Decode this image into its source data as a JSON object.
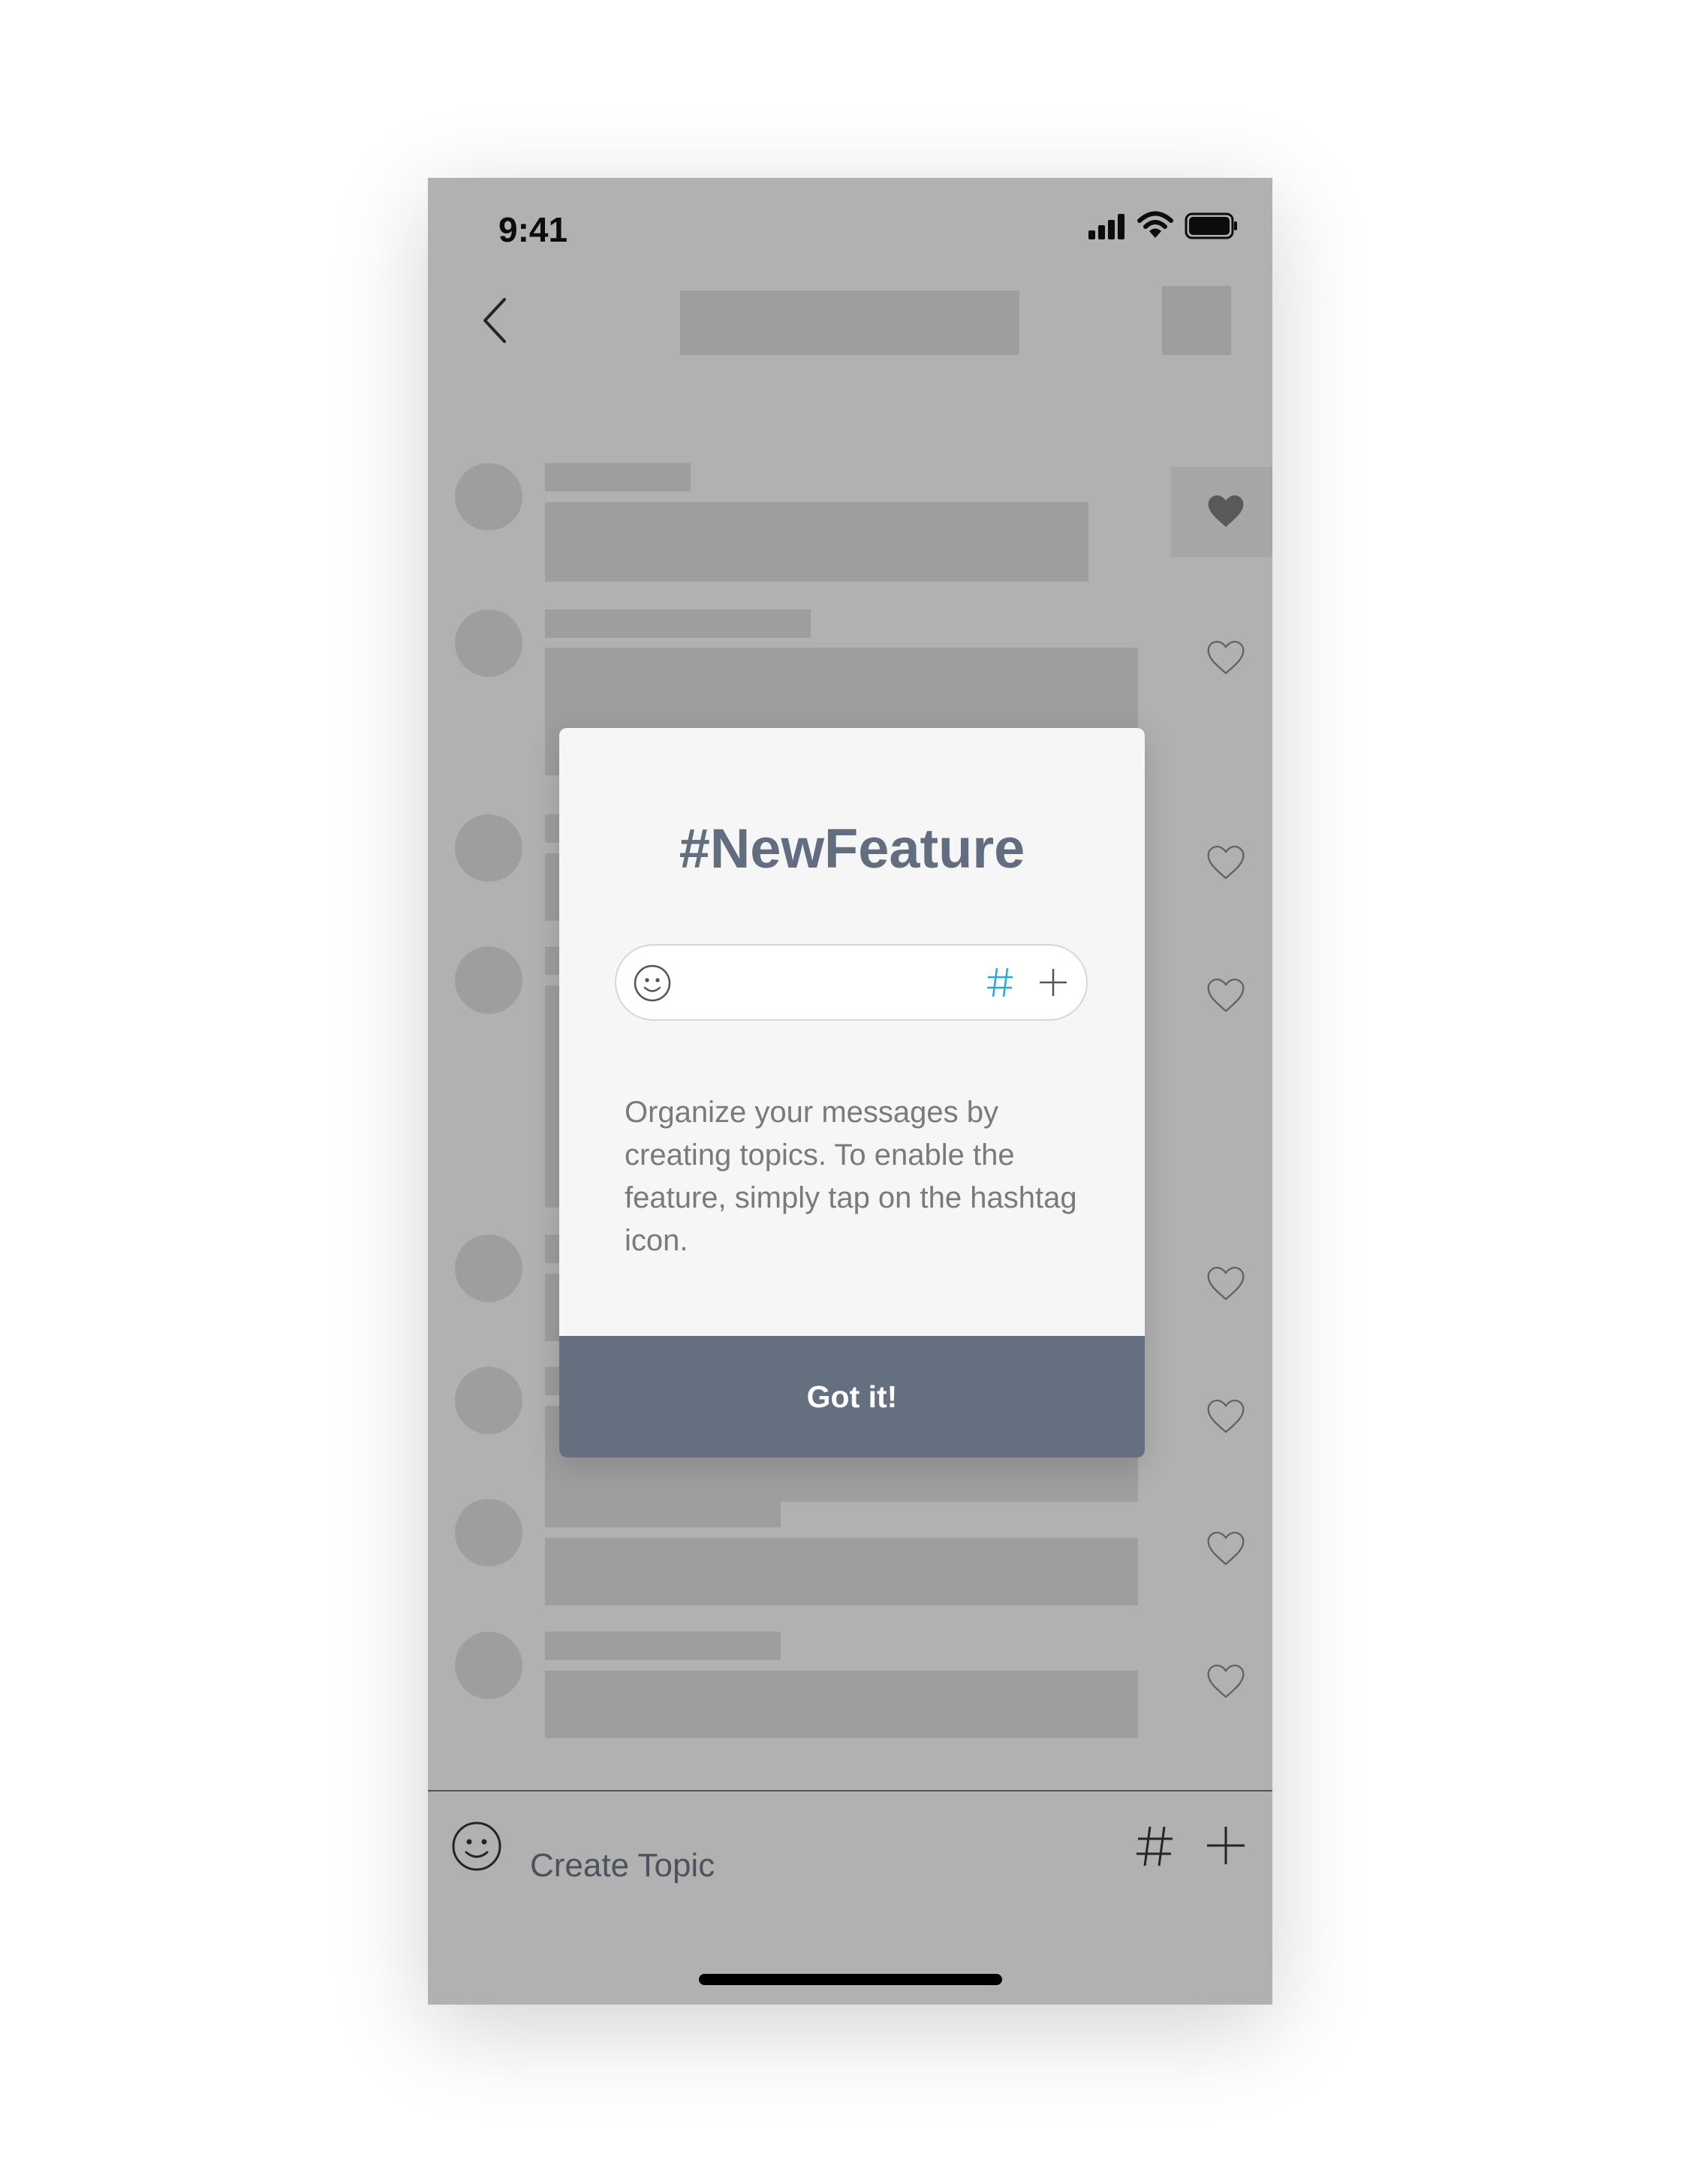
{
  "status_bar": {
    "time": "9:41"
  },
  "modal": {
    "title": "#NewFeature",
    "description": "Organize your messages by creating topics. To enable the feature, simply tap on the hashtag icon.",
    "button_label": "Got it!"
  },
  "composer": {
    "placeholder": "Create Topic"
  },
  "colors": {
    "accent_hashtag": "#2aa6df",
    "button": "#647080",
    "title": "#626e80"
  },
  "icons": [
    "back-chevron-icon",
    "signal-icon",
    "wifi-icon",
    "battery-icon",
    "heart-icon",
    "smiley-icon",
    "hashtag-icon",
    "plus-icon"
  ]
}
